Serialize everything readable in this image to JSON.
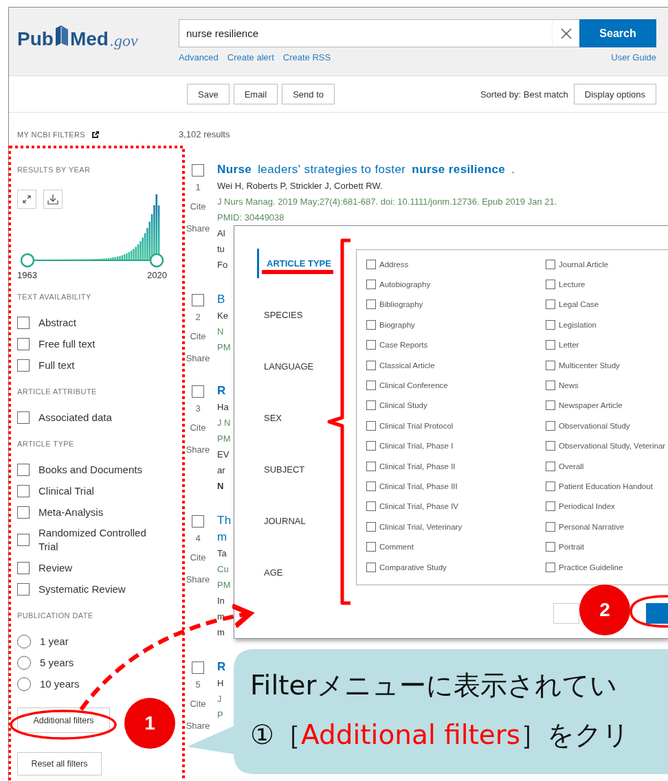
{
  "header": {
    "logo": {
      "first": "Pub",
      "second": "Med",
      "domain": ".gov"
    },
    "search": {
      "value": "nurse resilience",
      "button": "Search"
    },
    "links": [
      "Advanced",
      "Create alert",
      "Create RSS"
    ],
    "user_guide": "User Guide"
  },
  "toolbar": {
    "buttons": [
      "Save",
      "Email",
      "Send to"
    ],
    "sort_label": "Sorted by: Best match",
    "display_options": "Display options"
  },
  "sidebar": {
    "title": "MY NCBI FILTERS",
    "timeline": {
      "heading": "RESULTS BY YEAR",
      "start_year": "1963",
      "end_year": "2020"
    },
    "groups": [
      {
        "heading": "TEXT AVAILABILITY",
        "kind": "checkbox",
        "options": [
          {
            "label": "Abstract",
            "checked": false
          },
          {
            "label": "Free full text",
            "checked": false
          },
          {
            "label": "Full text",
            "checked": false
          }
        ]
      },
      {
        "heading": "ARTICLE ATTRIBUTE",
        "kind": "checkbox",
        "options": [
          {
            "label": "Associated data",
            "checked": false
          }
        ]
      },
      {
        "heading": "ARTICLE TYPE",
        "kind": "checkbox",
        "options": [
          {
            "label": "Books and Documents",
            "checked": false
          },
          {
            "label": "Clinical Trial",
            "checked": false
          },
          {
            "label": "Meta-Analysis",
            "checked": false
          },
          {
            "label": "Randomized Controlled Trial",
            "checked": false
          },
          {
            "label": "Review",
            "checked": false
          },
          {
            "label": "Systematic Review",
            "checked": false
          }
        ]
      },
      {
        "heading": "PUBLICATION DATE",
        "kind": "radio",
        "options": [
          {
            "label": "1 year",
            "selected": false
          },
          {
            "label": "5 years",
            "selected": false
          },
          {
            "label": "10 years",
            "selected": false
          }
        ]
      }
    ],
    "additional_filters": "Additional filters",
    "reset": "Reset all filters"
  },
  "results": {
    "count": "3,102 results",
    "items": [
      {
        "number": "1",
        "cite": "Cite",
        "share": "Share",
        "checked": false,
        "lines": [
          {
            "kind": "title",
            "text": "**Nurse** leaders' strategies to foster **nurse resilience**."
          },
          {
            "kind": "authors",
            "text": "Wei H, Roberts P, Strickler J, Corbett RW."
          },
          {
            "kind": "source",
            "text": "J Nurs Manag. 2019 May;27(4):681-687. doi: 10.1111/jonm.12736. Epub 2019 Jan 21."
          },
          {
            "kind": "source",
            "text": "PMID: 30449038"
          },
          {
            "kind": "snippet",
            "text": "Al"
          },
          {
            "kind": "snippet",
            "text": "tu"
          },
          {
            "kind": "snippet",
            "text": "Fo"
          }
        ]
      },
      {
        "number": "2",
        "cite": "Cite",
        "share": "Share",
        "checked": false,
        "lines": [
          {
            "kind": "title",
            "text": "B"
          },
          {
            "kind": "authors",
            "text": "Ke"
          },
          {
            "kind": "source",
            "text": "N"
          },
          {
            "kind": "source",
            "text": "PM"
          }
        ]
      },
      {
        "number": "3",
        "cite": "Cite",
        "share": "Share",
        "checked": false,
        "lines": [
          {
            "kind": "title",
            "text": "**R**"
          },
          {
            "kind": "authors",
            "text": "Ha"
          },
          {
            "kind": "source",
            "text": "J N"
          },
          {
            "kind": "source",
            "text": "PM"
          },
          {
            "kind": "snippet",
            "text": "EV"
          },
          {
            "kind": "snippet",
            "text": "ar"
          },
          {
            "kind": "snippet",
            "text": "**N**"
          }
        ]
      },
      {
        "number": "4",
        "cite": "Cite",
        "share": "Share",
        "checked": false,
        "lines": [
          {
            "kind": "title",
            "text": "Th"
          },
          {
            "kind": "title",
            "text": "m"
          },
          {
            "kind": "authors",
            "text": "Ta"
          },
          {
            "kind": "source",
            "text": "Cu"
          },
          {
            "kind": "source",
            "text": "PM"
          },
          {
            "kind": "snippet",
            "text": "In"
          },
          {
            "kind": "snippet",
            "text": "m"
          },
          {
            "kind": "snippet",
            "text": "m"
          }
        ]
      },
      {
        "number": "5",
        "cite": "Cite",
        "share": "Share",
        "checked": false,
        "lines": [
          {
            "kind": "title",
            "text": "**R**"
          },
          {
            "kind": "authors",
            "text": "H"
          },
          {
            "kind": "source",
            "text": "J"
          },
          {
            "kind": "source",
            "text": "P"
          }
        ]
      }
    ]
  },
  "dialog": {
    "tabs": [
      {
        "label": "ARTICLE TYPE",
        "selected": true
      },
      {
        "label": "SPECIES",
        "selected": false
      },
      {
        "label": "LANGUAGE",
        "selected": false
      },
      {
        "label": "SEX",
        "selected": false
      },
      {
        "label": "SUBJECT",
        "selected": false
      },
      {
        "label": "JOURNAL",
        "selected": false
      },
      {
        "label": "AGE",
        "selected": false
      }
    ],
    "columns": [
      [
        {
          "label": "Address",
          "checked": false
        },
        {
          "label": "Autobiography",
          "checked": false
        },
        {
          "label": "Bibliography",
          "checked": false
        },
        {
          "label": "Biography",
          "checked": false
        },
        {
          "label": "Case Reports",
          "checked": false
        },
        {
          "label": "Classical Article",
          "checked": false
        },
        {
          "label": "Clinical Conference",
          "checked": false
        },
        {
          "label": "Clinical Study",
          "checked": false
        },
        {
          "label": "Clinical Trial Protocol",
          "checked": false
        },
        {
          "label": "Clinical Trial, Phase I",
          "checked": false
        },
        {
          "label": "Clinical Trial, Phase II",
          "checked": false
        },
        {
          "label": "Clinical Trial, Phase III",
          "checked": false
        },
        {
          "label": "Clinical Trial, Phase IV",
          "checked": false
        },
        {
          "label": "Clinical Trial, Veterinary",
          "checked": false
        },
        {
          "label": "Comment",
          "checked": false
        },
        {
          "label": "Comparative Study",
          "checked": false
        }
      ],
      [
        {
          "label": "Journal Article",
          "checked": false
        },
        {
          "label": "Lecture",
          "checked": false
        },
        {
          "label": "Legal Case",
          "checked": false
        },
        {
          "label": "Legislation",
          "checked": false
        },
        {
          "label": "Letter",
          "checked": false
        },
        {
          "label": "Multicenter Study",
          "checked": false
        },
        {
          "label": "News",
          "checked": false
        },
        {
          "label": "Newspaper Article",
          "checked": false
        },
        {
          "label": "Observational Study",
          "checked": false
        },
        {
          "label": "Observational Study, Veterinar",
          "checked": false
        },
        {
          "label": "Overall",
          "checked": false
        },
        {
          "label": "Patient Education Handout",
          "checked": false
        },
        {
          "label": "Periodical Index",
          "checked": false
        },
        {
          "label": "Personal Narrative",
          "checked": false
        },
        {
          "label": "Portrait",
          "checked": false
        },
        {
          "label": "Practice Guideline",
          "checked": false
        }
      ]
    ],
    "actions": [
      {
        "kind": "secondary"
      },
      {
        "kind": "primary"
      }
    ]
  },
  "annotations": {
    "badges": [
      "1",
      "2"
    ],
    "callout": {
      "line_1": "Filterメニューに表示されてい",
      "line_2": [
        {
          "text": "①［",
          "highlight": false
        },
        {
          "text": "Additional filters",
          "highlight": true
        },
        {
          "text": "］をクリ",
          "highlight": false
        }
      ]
    }
  }
}
